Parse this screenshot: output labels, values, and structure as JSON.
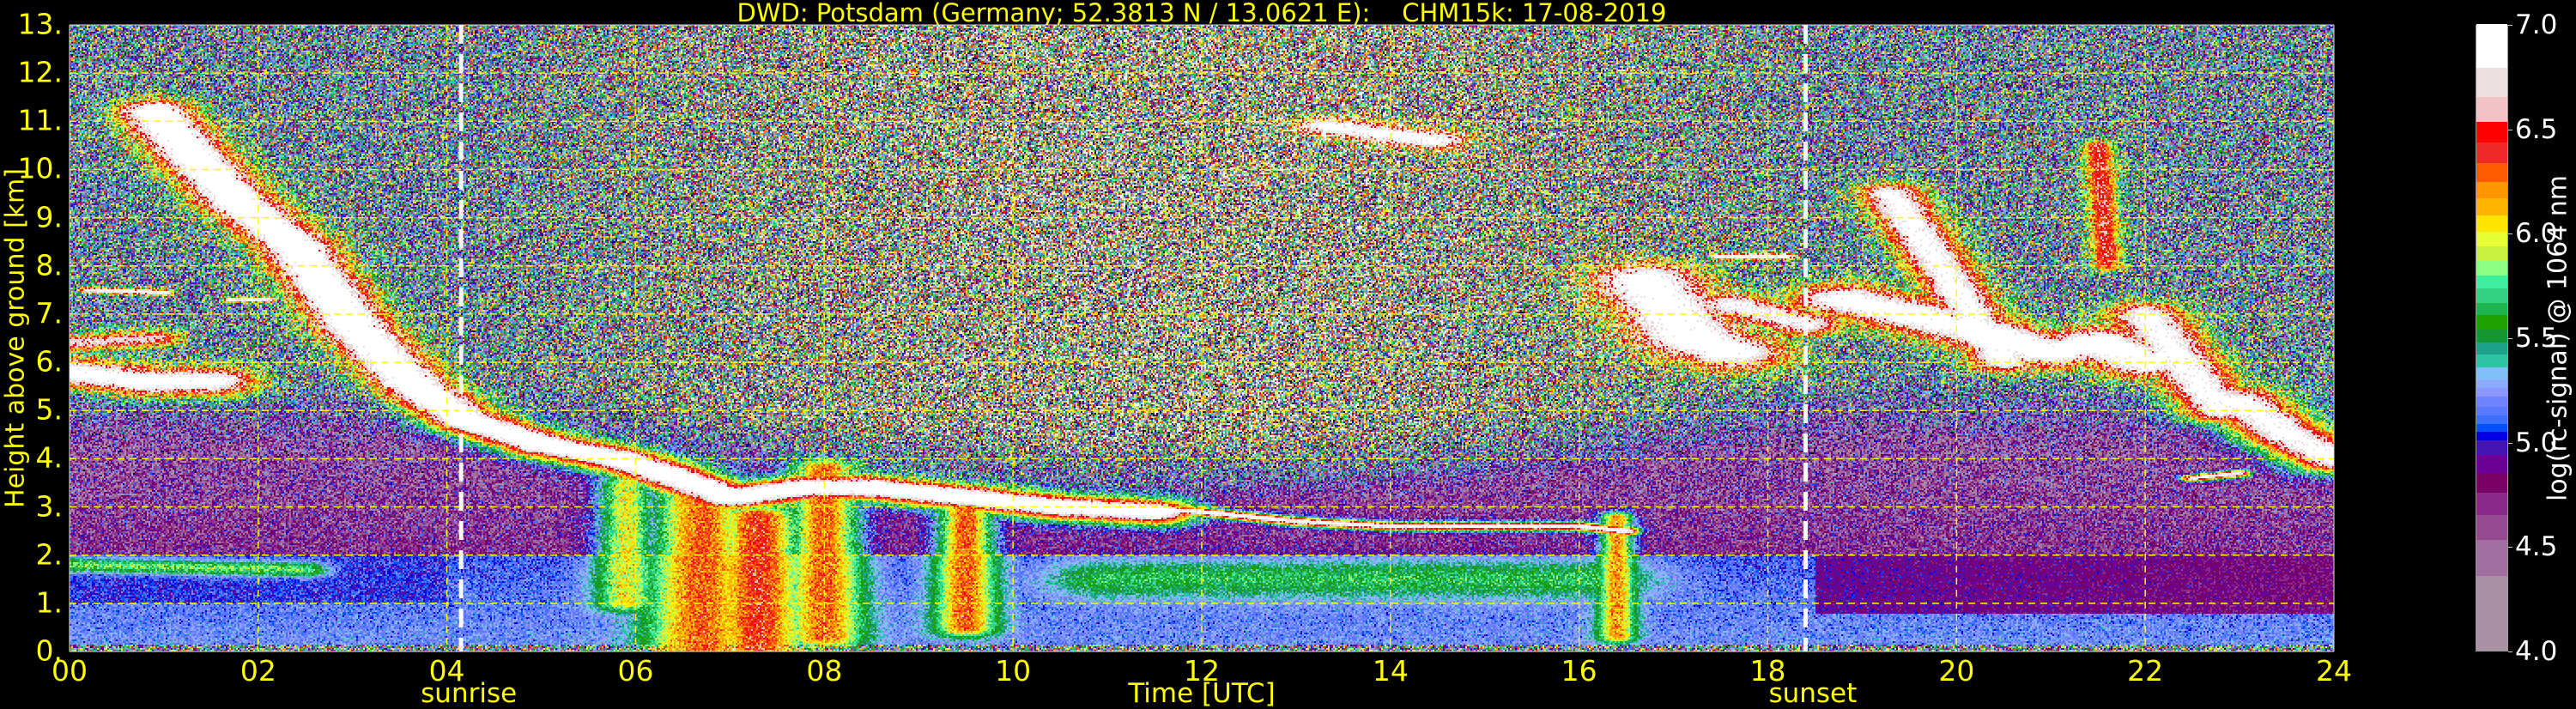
{
  "chart_data": {
    "type": "heatmap",
    "title": "DWD: Potsdam (Germany; 52.3813 N / 13.0621 E):    CHM15k: 17-08-2019",
    "xlabel": "Time [UTC]",
    "ylabel": "Height above ground [km]",
    "xlim": [
      0,
      24
    ],
    "ylim": [
      0,
      13
    ],
    "grid": true,
    "x_ticks": [
      "00",
      "02",
      "04",
      "06",
      "08",
      "10",
      "12",
      "14",
      "16",
      "18",
      "20",
      "22",
      "24"
    ],
    "x_tick_values": [
      0,
      2,
      4,
      6,
      8,
      10,
      12,
      14,
      16,
      18,
      20,
      22,
      24
    ],
    "y_ticks": [
      "0.",
      "1.",
      "2.",
      "3.",
      "4.",
      "5.",
      "6.",
      "7.",
      "8.",
      "9.",
      "10.",
      "11.",
      "12.",
      "13."
    ],
    "y_tick_values": [
      0,
      1,
      2,
      3,
      4,
      5,
      6,
      7,
      8,
      9,
      10,
      11,
      12,
      13
    ],
    "annotations": [
      {
        "label": "sunrise",
        "time": 4.15,
        "color": "#ffffff"
      },
      {
        "label": "sunset",
        "time": 18.4,
        "color": "#ffffff"
      }
    ],
    "colorbar": {
      "label": "log(rc-signal) @ 1064 nm",
      "range": [
        4.0,
        7.0
      ],
      "ticks": [
        "4.0",
        "4.5",
        "5.0",
        "5.5",
        "6.0",
        "6.5",
        "7.0"
      ],
      "tick_values": [
        4.0,
        4.5,
        5.0,
        5.5,
        6.0,
        6.5,
        7.0
      ],
      "levels": [
        [
          4.0,
          "#aa91a5"
        ],
        [
          4.36,
          "#a06ea0"
        ],
        [
          4.53,
          "#964b91"
        ],
        [
          4.65,
          "#8c2887"
        ],
        [
          4.76,
          "#780064"
        ],
        [
          4.85,
          "#6e0096"
        ],
        [
          4.94,
          "#4614b4"
        ],
        [
          5.01,
          "#0000e6"
        ],
        [
          5.05,
          "#0050ff"
        ],
        [
          5.09,
          "#3c6eff"
        ],
        [
          5.13,
          "#5a78ff"
        ],
        [
          5.17,
          "#6e82ff"
        ],
        [
          5.22,
          "#8c96ff"
        ],
        [
          5.26,
          "#8caaff"
        ],
        [
          5.3,
          "#82befa"
        ],
        [
          5.36,
          "#2dc3a5"
        ],
        [
          5.42,
          "#1ea08c"
        ],
        [
          5.48,
          "#149632"
        ],
        [
          5.54,
          "#1ea000"
        ],
        [
          5.61,
          "#1eb450"
        ],
        [
          5.67,
          "#32d282"
        ],
        [
          5.74,
          "#3cf0a0"
        ],
        [
          5.8,
          "#8cff82"
        ],
        [
          5.87,
          "#c8f03c"
        ],
        [
          5.94,
          "#e6ff32"
        ],
        [
          6.01,
          "#ffe600"
        ],
        [
          6.09,
          "#ffb400"
        ],
        [
          6.17,
          "#ff9600"
        ],
        [
          6.25,
          "#ff5a00"
        ],
        [
          6.34,
          "#f02828"
        ],
        [
          6.44,
          "#ff0000"
        ],
        [
          6.54,
          "#f0c4c4"
        ],
        [
          6.66,
          "#ebe0e0"
        ],
        [
          6.8,
          "#ffffff"
        ]
      ]
    },
    "features": [
      {
        "name": "descending-cirrus-to-midlevel",
        "peak": 7.2,
        "width_km": 0.3,
        "points": [
          [
            0.9,
            11.2
          ],
          [
            1.3,
            10.3
          ],
          [
            1.8,
            9.3
          ],
          [
            2.4,
            8.4
          ],
          [
            3.0,
            6.8
          ],
          [
            3.6,
            5.6
          ],
          [
            4.2,
            4.8
          ],
          [
            5.0,
            4.3
          ],
          [
            5.8,
            4.0
          ],
          [
            6.3,
            3.7
          ],
          [
            7.0,
            3.2
          ],
          [
            7.8,
            3.4
          ],
          [
            8.5,
            3.4
          ],
          [
            9.5,
            3.2
          ],
          [
            10.5,
            3.0
          ],
          [
            11.5,
            2.9
          ]
        ]
      },
      {
        "name": "night-cloud-5.7km",
        "peak": 7.1,
        "width_km": 0.35,
        "points": [
          [
            0,
            5.8
          ],
          [
            0.8,
            5.6
          ],
          [
            1.5,
            5.6
          ]
        ]
      },
      {
        "name": "night-cloud-6.4km",
        "peak": 6.7,
        "width_km": 0.2,
        "points": [
          [
            0,
            6.4
          ],
          [
            0.9,
            6.5
          ]
        ]
      },
      {
        "name": "thin-layer-7.4km",
        "peak": 7.1,
        "width_km": 0.07,
        "points": [
          [
            0.2,
            7.5
          ],
          [
            1.0,
            7.45
          ]
        ]
      },
      {
        "name": "thin-layer-7.3km",
        "peak": 7.0,
        "width_km": 0.06,
        "points": [
          [
            1.7,
            7.3
          ],
          [
            2.1,
            7.3
          ]
        ]
      },
      {
        "name": "afternoon-layer-2.7km",
        "peak": 7.0,
        "width_km": 0.1,
        "points": [
          [
            11,
            3.0
          ],
          [
            12,
            2.9
          ],
          [
            13,
            2.7
          ],
          [
            14,
            2.6
          ],
          [
            15,
            2.6
          ],
          [
            16,
            2.6
          ],
          [
            16.5,
            2.5
          ]
        ]
      },
      {
        "name": "convective-plume-1",
        "peak": 6.3,
        "width_km": 0.35,
        "points": [
          [
            6.7,
            0.1
          ],
          [
            6.7,
            3.3
          ]
        ]
      },
      {
        "name": "convective-plume-2",
        "peak": 6.4,
        "width_km": 0.3,
        "points": [
          [
            7.3,
            0.1
          ],
          [
            7.3,
            2.8
          ]
        ]
      },
      {
        "name": "convective-plume-3",
        "peak": 6.3,
        "width_km": 0.25,
        "points": [
          [
            8.0,
            0.3
          ],
          [
            8.0,
            3.8
          ]
        ]
      },
      {
        "name": "convective-plume-4",
        "peak": 6.3,
        "width_km": 0.2,
        "points": [
          [
            9.5,
            0.5
          ],
          [
            9.5,
            3.2
          ]
        ]
      },
      {
        "name": "convective-plume-5",
        "peak": 6.0,
        "width_km": 0.2,
        "points": [
          [
            5.9,
            1.0
          ],
          [
            5.9,
            3.5
          ]
        ]
      },
      {
        "name": "convective-plume-6",
        "peak": 6.2,
        "width_km": 0.12,
        "points": [
          [
            16.4,
            0.3
          ],
          [
            16.4,
            2.8
          ]
        ]
      },
      {
        "name": "cirrus-10.8km",
        "peak": 7.0,
        "width_km": 0.25,
        "points": [
          [
            13.3,
            10.9
          ],
          [
            14.5,
            10.6
          ]
        ]
      },
      {
        "name": "cirrus-evening-1",
        "peak": 7.1,
        "width_km": 0.45,
        "points": [
          [
            16.7,
            7.7
          ],
          [
            17.2,
            6.5
          ],
          [
            17.6,
            6.2
          ]
        ]
      },
      {
        "name": "cirrus-evening-8.2km",
        "peak": 7.1,
        "width_km": 0.08,
        "points": [
          [
            17.5,
            8.2
          ],
          [
            18.2,
            8.2
          ]
        ]
      },
      {
        "name": "cirrus-evening-2",
        "peak": 6.9,
        "width_km": 0.3,
        "points": [
          [
            17.6,
            7.2
          ],
          [
            18.4,
            6.8
          ]
        ]
      },
      {
        "name": "cirrus-evening-3",
        "peak": 7.1,
        "width_km": 0.4,
        "points": [
          [
            18.8,
            7.3
          ],
          [
            19.5,
            7.0
          ],
          [
            20.3,
            6.6
          ],
          [
            21,
            6.2
          ],
          [
            21.5,
            6.4
          ],
          [
            22,
            6.0
          ]
        ]
      },
      {
        "name": "cirrus-evening-4",
        "peak": 7.0,
        "width_km": 0.25,
        "points": [
          [
            19.3,
            9.5
          ],
          [
            20,
            7.5
          ],
          [
            20.5,
            6.0
          ]
        ]
      },
      {
        "name": "fallstreak-21.5h",
        "peak": 6.5,
        "width_km": 0.12,
        "points": [
          [
            21.5,
            10.5
          ],
          [
            21.6,
            8.0
          ]
        ]
      },
      {
        "name": "cirrus-evening-5",
        "peak": 7.0,
        "width_km": 0.3,
        "points": [
          [
            22,
            7.0
          ],
          [
            22.8,
            5.0
          ]
        ]
      },
      {
        "name": "cirrus-evening-6",
        "peak": 7.0,
        "width_km": 0.35,
        "points": [
          [
            23,
            5.2
          ],
          [
            23.5,
            4.5
          ],
          [
            24,
            4.0
          ]
        ]
      },
      {
        "name": "thin-layer-3.6km",
        "peak": 7.0,
        "width_km": 0.08,
        "points": [
          [
            22.5,
            3.6
          ],
          [
            23,
            3.7
          ]
        ]
      },
      {
        "name": "aerosol-top-night",
        "peak": 5.8,
        "width_km": 0.15,
        "points": [
          [
            0,
            1.8
          ],
          [
            2.5,
            1.7
          ]
        ]
      },
      {
        "name": "aerosol-layer-afternoon",
        "peak": 5.65,
        "width_km": 0.4,
        "points": [
          [
            11,
            1.5
          ],
          [
            16.2,
            1.5
          ]
        ]
      }
    ]
  }
}
